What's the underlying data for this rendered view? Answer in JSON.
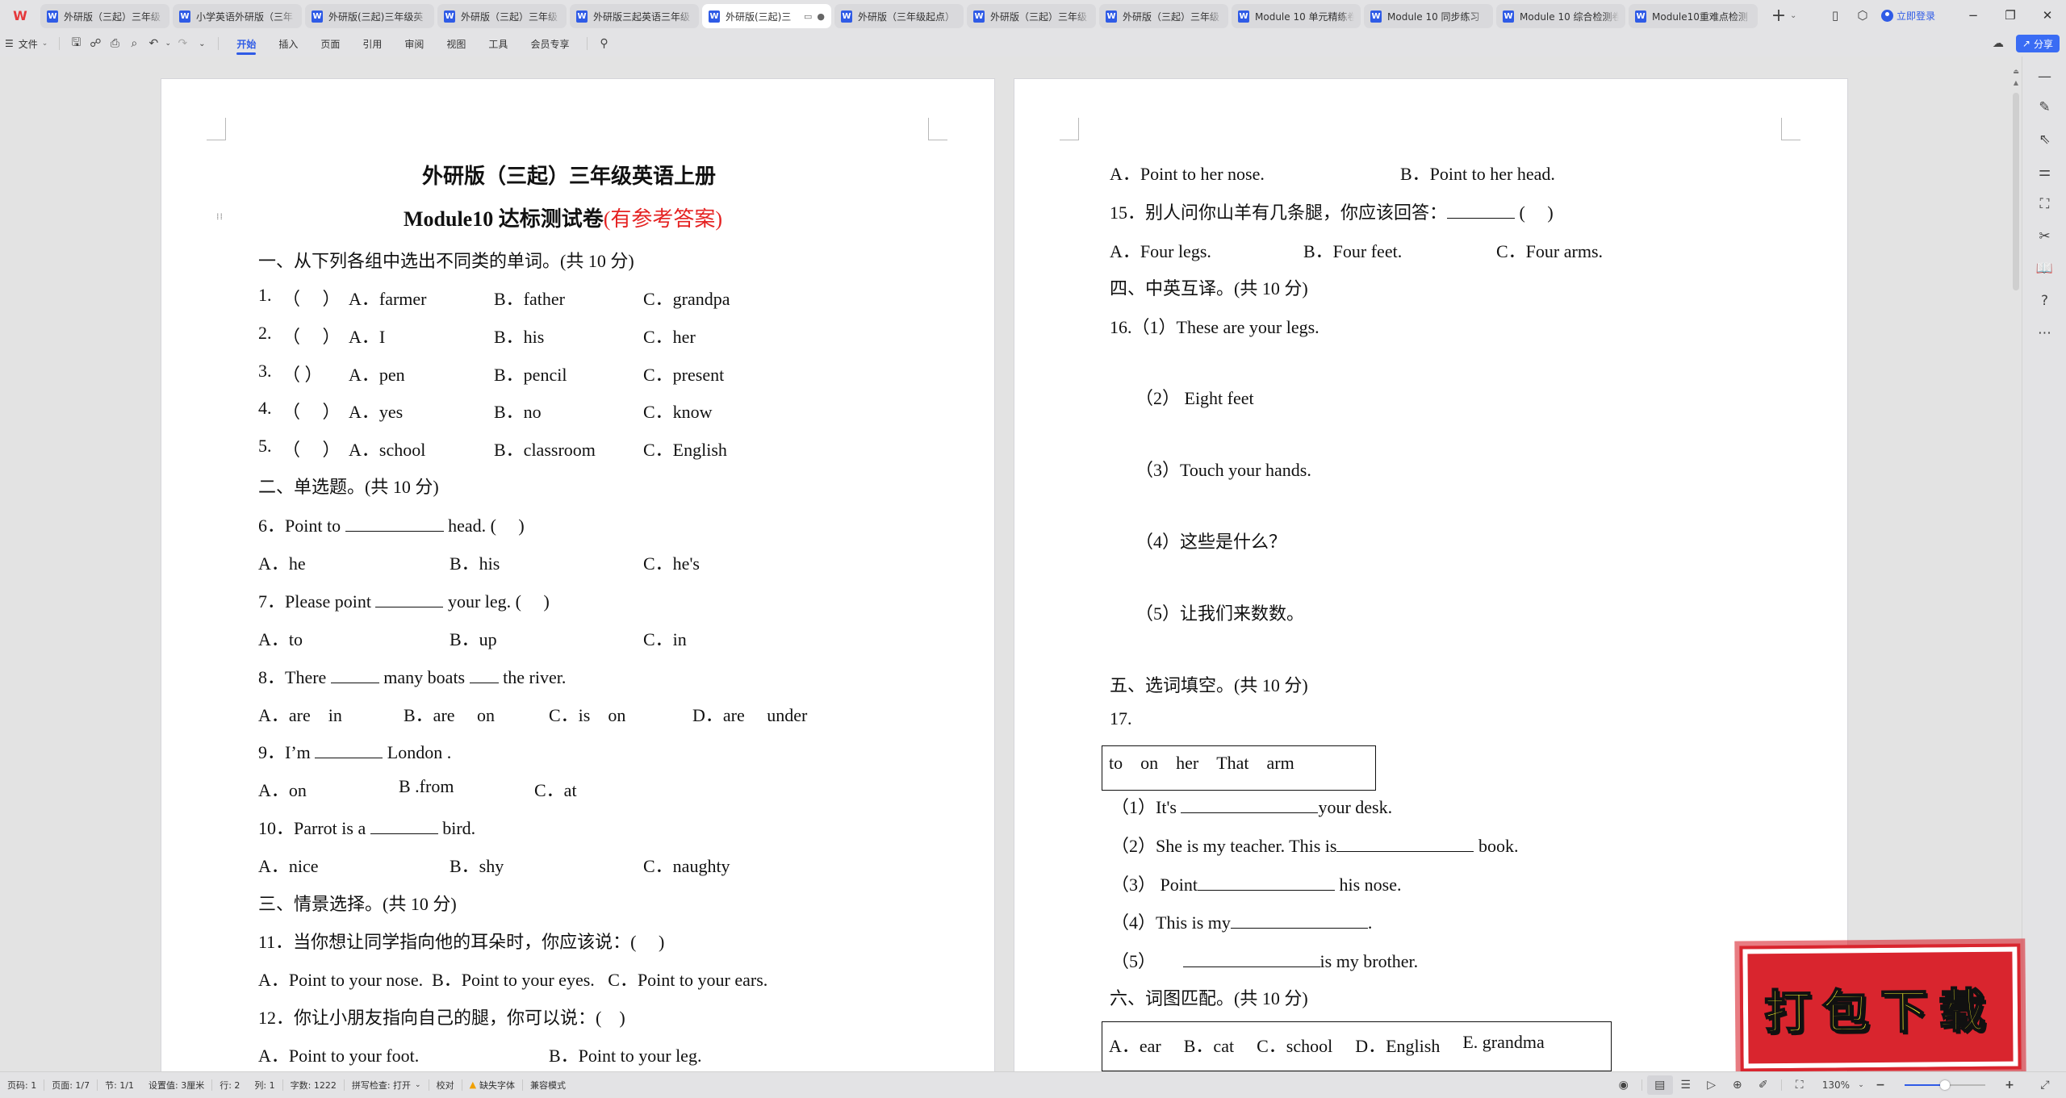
{
  "app": {
    "logo": "W",
    "tabs": [
      {
        "label": "外研版（三起）三年级",
        "active": false
      },
      {
        "label": "小学英语外研版（三年",
        "active": false
      },
      {
        "label": "外研版(三起)三年级英",
        "active": false
      },
      {
        "label": "外研版（三起）三年级",
        "active": false
      },
      {
        "label": "外研版三起英语三年级",
        "active": false
      },
      {
        "label": "外研版(三起)三",
        "active": true
      },
      {
        "label": "外研版（三年级起点）",
        "active": false
      },
      {
        "label": "外研版（三起）三年级",
        "active": false
      },
      {
        "label": "外研版（三起）三年级",
        "active": false
      },
      {
        "label": "Module 10 单元精练卷",
        "active": false
      },
      {
        "label": "Module 10 同步练习",
        "active": false
      },
      {
        "label": "Module 10 综合检测卷",
        "active": false
      },
      {
        "label": "Module10重难点检测",
        "active": false
      }
    ],
    "new_tab": "+",
    "login_label": "立即登录"
  },
  "toolbar": {
    "file_menu": "文件",
    "menu_tabs": [
      "开始",
      "插入",
      "页面",
      "引用",
      "审阅",
      "视图",
      "工具",
      "会员专享"
    ],
    "active_tab": "开始",
    "share_label": "分享"
  },
  "document": {
    "left_page": {
      "title": "外研版（三起）三年级英语上册",
      "subtitle": "Module10 达标测试卷",
      "subtitle_note": "(有参考答案)",
      "sections": {
        "s1": "一、从下列各组中选出不同类的单词。(共 10 分)",
        "s2": "二、单选题。(共 10 分)",
        "s3": "三、情景选择。(共 10 分)"
      },
      "q1": {
        "num": "1.",
        "paren": "（　 ）",
        "a": "A．farmer",
        "b": "B．father",
        "c": "C．grandpa"
      },
      "q2": {
        "num": "2.",
        "paren": "（　 ）",
        "a": "A．I",
        "b": "B．his",
        "c": "C．her"
      },
      "q3": {
        "num": "3.",
        "paren": "（ ）",
        "a": "A．pen",
        "b": "B．pencil",
        "c": "C．present"
      },
      "q4": {
        "num": "4.",
        "paren": "（　 ）",
        "a": "A．yes",
        "b": "B．no",
        "c": "C．know"
      },
      "q5": {
        "num": "5.",
        "paren": "（　 ）",
        "a": "A．school",
        "b": "B．classroom",
        "c": "C．English"
      },
      "q6": {
        "pre": "6．Point to ",
        "post": " head. (　 )",
        "a": "A．he",
        "b": "B．his",
        "c": "C．he's"
      },
      "q7": {
        "pre": "7．Please point ",
        "post": " your leg. (　 )",
        "a": "A．to",
        "b": "B．up",
        "c": "C．in"
      },
      "q8": {
        "pre": "8．There ",
        "mid": " many boats ",
        "post": " the river.",
        "a": "A．are　in",
        "b": "B．are　 on",
        "c": "C．is　on",
        "d": "D．are　 under"
      },
      "q9": {
        "pre": "9．I’m ",
        "post": " London .",
        "a": "A．on",
        "b": "B .from",
        "c": "C．at"
      },
      "q10": {
        "pre": "10．Parrot is a ",
        "post": " bird.",
        "a": "A．nice",
        "b": "B．shy",
        "c": "C．naughty"
      },
      "q11": {
        "text": "11．当你想让同学指向他的耳朵时，你应该说：(　 )",
        "options": "A．Point to your nose.  B．Point to your eyes.   C．Point to your ears."
      },
      "q12": {
        "text": "12．你让小朋友指向自己的腿，你可以说：(　)",
        "a": "A．Point to your foot.",
        "b": "B．Point to your leg."
      }
    },
    "right_page": {
      "q14_opts": {
        "a": "A．Point to her nose.",
        "b": "B．Point to her head."
      },
      "q15": {
        "text": "15．别人问你山羊有几条腿，你应该回答：",
        "paren": " (　 )",
        "a": "A．Four legs.",
        "b": "B．Four feet.",
        "c": "C．Four arms."
      },
      "sections": {
        "s4": "四、中英互译。(共 10 分)",
        "s5": "五、选词填空。(共 10 分)",
        "s6": "六、词图匹配。(共 10 分)"
      },
      "q16": {
        "i1": "16.（1）These are your legs.",
        "i2": "（2） Eight feet",
        "i3": "（3）Touch your hands.",
        "i4": "（4）这些是什么？",
        "i5": "（5）让我们来数数。"
      },
      "q17": {
        "num": "17.",
        "word_bank": [
          "to",
          "on",
          "her",
          "That",
          "arm"
        ],
        "i1_pre": "（1）It's ",
        "i1_post": "your desk.",
        "i2_pre": "（2）She is my teacher. This is",
        "i2_post": " book.",
        "i3_pre": "（3） Point",
        "i3_post": " his nose.",
        "i4_pre": "（4）This is my",
        "i4_post": ".",
        "i5_pre": "（5） ",
        "i5_post": "is my brother."
      },
      "q18_bank": [
        "A．ear",
        "B．cat",
        "C．school",
        "D．English",
        "E. grandma"
      ]
    }
  },
  "statusbar": {
    "page_num": "页码: 1",
    "pages": "页面: 1/7",
    "section": "节: 1/1",
    "setting": "设置值: 3厘米",
    "row": "行: 2",
    "col": "列: 1",
    "word_count": "字数: 1222",
    "spell_check": "拼写检查: 打开",
    "proofread": "校对",
    "missing_fonts": "缺失字体",
    "compat_mode": "兼容模式",
    "zoom": "130%",
    "zoom_fraction": 0.5
  },
  "stamp": {
    "label": "打包下载",
    "bg_color": "#d9252e",
    "text_color": "#f8f32b"
  }
}
